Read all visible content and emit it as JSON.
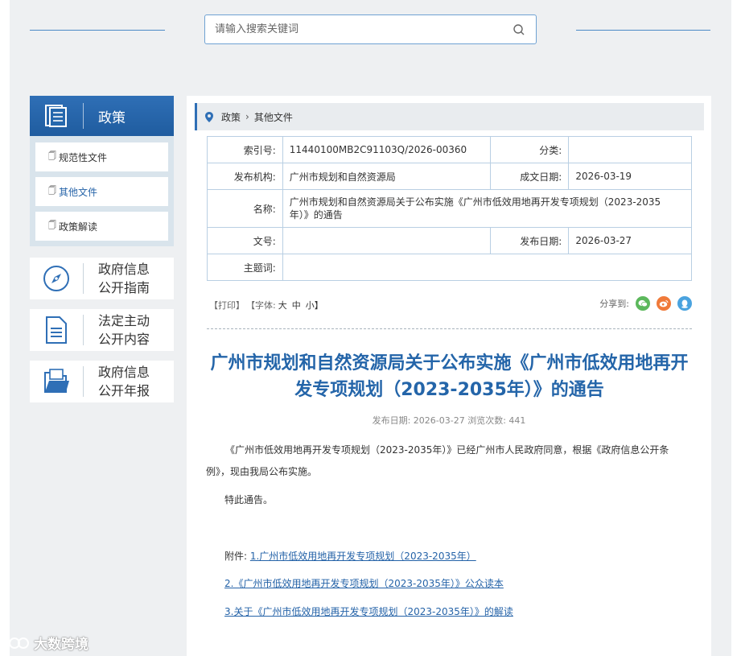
{
  "search": {
    "placeholder": "请输入搜索关键词"
  },
  "sidebar": {
    "title": "政策",
    "items": [
      {
        "label": "规范性文件"
      },
      {
        "label": "其他文件"
      },
      {
        "label": "政策解读"
      }
    ],
    "cards": [
      {
        "line1": "政府信息",
        "line2": "公开指南",
        "icon": "compass-icon"
      },
      {
        "line1": "法定主动",
        "line2": "公开内容",
        "icon": "document-icon"
      },
      {
        "line1": "政府信息",
        "line2": "公开年报",
        "icon": "folder-icon"
      }
    ]
  },
  "breadcrumb": {
    "root": "政策",
    "current": "其他文件"
  },
  "meta": {
    "index_label": "索引号:",
    "index_value": "11440100MB2C91103Q/2026-00360",
    "category_label": "分类:",
    "category_value": "",
    "issuer_label": "发布机构:",
    "issuer_value": "广州市规划和自然资源局",
    "created_label": "成文日期:",
    "created_value": "2026-03-19",
    "name_label": "名称:",
    "name_value": "广州市规划和自然资源局关于公布实施《广州市低效用地再开发专项规划（2023-2035年）》的通告",
    "docno_label": "文号:",
    "docno_value": "",
    "published_label": "发布日期:",
    "published_value": "2026-03-27",
    "subject_label": "主题词:",
    "subject_value": ""
  },
  "tools": {
    "print": "【打印】",
    "font_prefix": "【字体:",
    "size_large": "大",
    "size_medium": "中",
    "size_small": "小】",
    "share_label": "分享到:"
  },
  "article": {
    "title": "广州市规划和自然资源局关于公布实施《广州市低效用地再开发专项规划（2023-2035年）》的通告",
    "pub_info": "发布日期: 2026-03-27  浏览次数: 441",
    "paragraph1": "《广州市低效用地再开发专项规划（2023-2035年）》已经广州市人民政府同意，根据《政府信息公开条例》，现由我局公布实施。",
    "paragraph2": "特此通告。",
    "attachment_prefix": "附件: ",
    "attachments": [
      "1.广州市低效用地再开发专项规划（2023-2035年）",
      "2.《广州市低效用地再开发专项规划（2023-2035年）》公众读本",
      "3.关于《广州市低效用地再开发专项规划（2023-2035年）》的解读"
    ]
  },
  "watermark": "大数跨境",
  "colors": {
    "accent": "#2f6fb6",
    "title": "#2465a9",
    "link": "#2563a8"
  }
}
